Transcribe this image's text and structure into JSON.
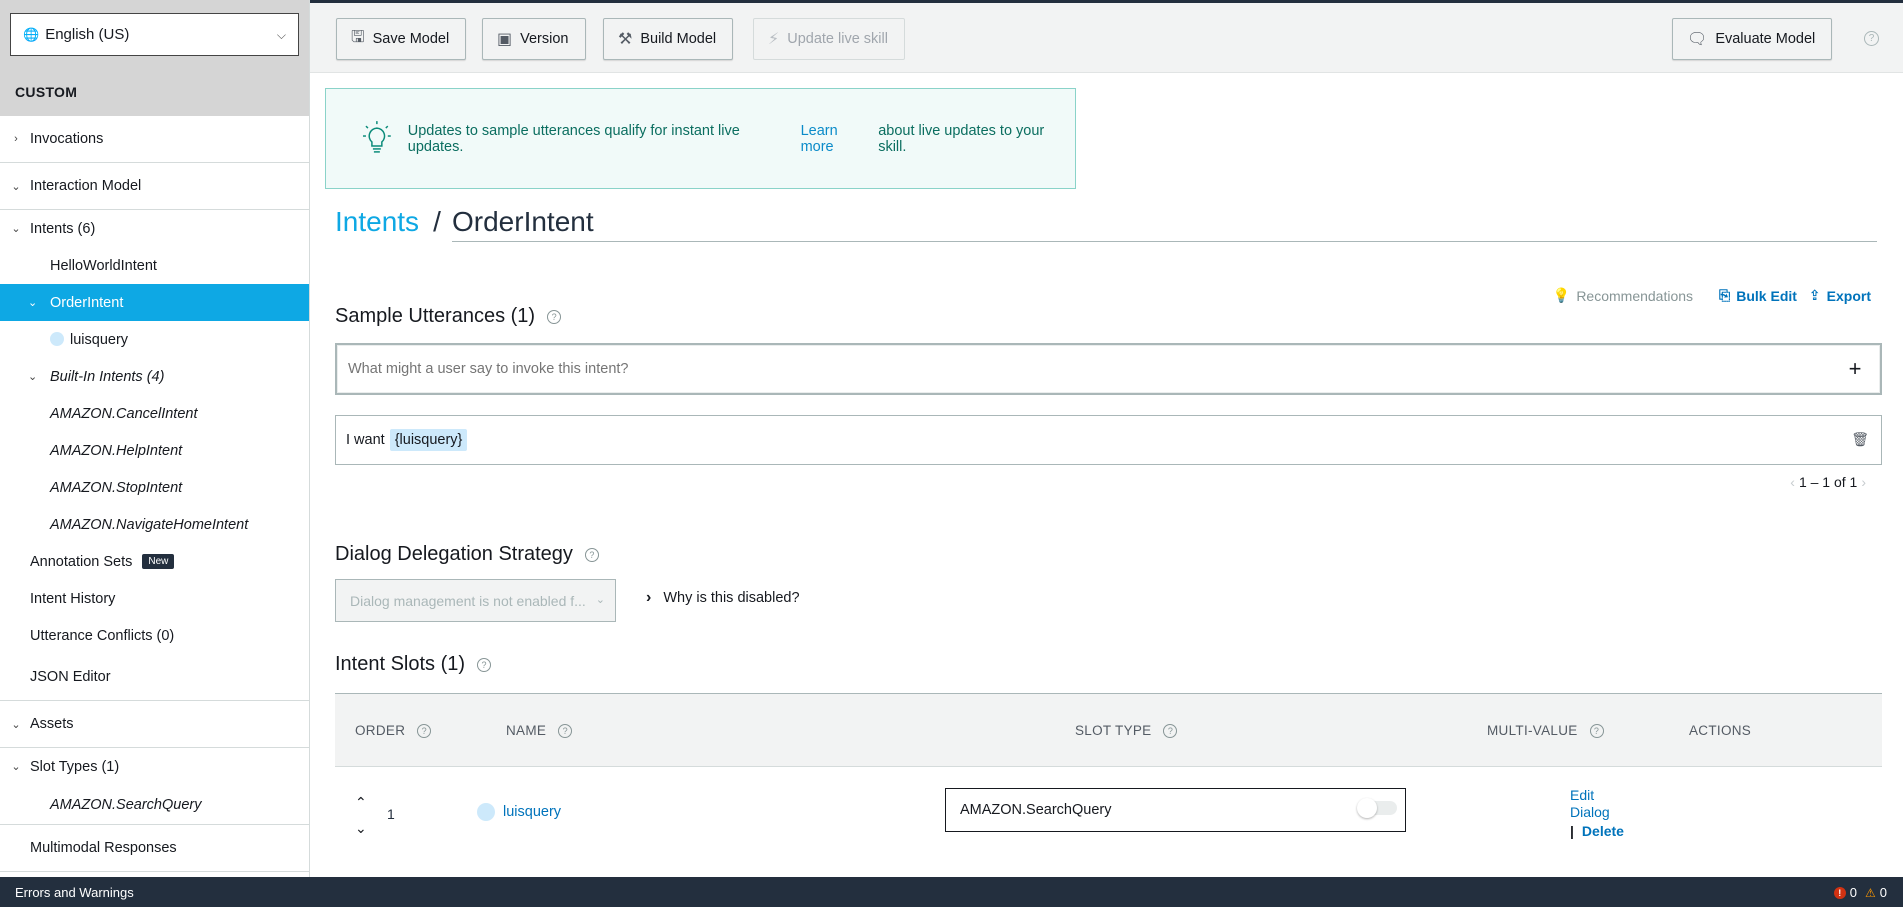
{
  "sidebar": {
    "language": "English (US)",
    "section_label": "CUSTOM",
    "invocations": "Invocations",
    "interaction_model": "Interaction Model",
    "intents": "Intents (6)",
    "hello_world_intent": "HelloWorldIntent",
    "order_intent": "OrderIntent",
    "order_slot": "luisquery",
    "builtin_intents": "Built-In Intents (4)",
    "builtin_items": [
      "AMAZON.CancelIntent",
      "AMAZON.HelpIntent",
      "AMAZON.StopIntent",
      "AMAZON.NavigateHomeIntent"
    ],
    "annotation_sets": "Annotation Sets",
    "new_badge": "New",
    "intent_history": "Intent History",
    "utterance_conflicts": "Utterance Conflicts (0)",
    "json_editor": "JSON Editor",
    "assets": "Assets",
    "slot_types": "Slot Types (1)",
    "slot_type_item": "AMAZON.SearchQuery",
    "multimodal": "Multimodal Responses"
  },
  "toolbar": {
    "save": "Save Model",
    "version": "Version",
    "build": "Build Model",
    "update_live": "Update live skill",
    "evaluate": "Evaluate Model",
    "help": "?"
  },
  "banner": {
    "text_before": "Updates to sample utterances qualify for instant live updates.",
    "link": "Learn more",
    "text_after": "about live updates to your skill."
  },
  "breadcrumb": {
    "parent": "Intents",
    "separator": "/",
    "current": "OrderIntent"
  },
  "utterances": {
    "title": "Sample Utterances (1)",
    "recommendations": "Recommendations",
    "bulk_edit": "Bulk Edit",
    "export": "Export",
    "placeholder": "What might a user say to invoke this intent?",
    "rows": [
      {
        "prefix": "I want",
        "slot": "{luisquery}"
      }
    ],
    "pagination": "1 – 1 of 1"
  },
  "dialog": {
    "title": "Dialog Delegation Strategy",
    "select_value": "Dialog management is not enabled f...",
    "why_disabled": "Why is this disabled?"
  },
  "slots": {
    "title": "Intent Slots (1)",
    "headers": {
      "order": "ORDER",
      "name": "NAME",
      "slot_type": "SLOT TYPE",
      "multi_value": "MULTI-VALUE",
      "actions": "ACTIONS"
    },
    "rows": [
      {
        "order": "1",
        "name": "luisquery",
        "slot_type": "AMAZON.SearchQuery",
        "multi_value": false,
        "edit_dialog": "Edit Dialog",
        "delete": "Delete"
      }
    ]
  },
  "statusbar": {
    "label": "Errors and Warnings",
    "errors": "0",
    "warnings": "0"
  },
  "colors": {
    "accent": "#0ea8e4",
    "link": "#0073bb",
    "dark": "#232f3e",
    "banner_bg": "#f1faf9"
  }
}
